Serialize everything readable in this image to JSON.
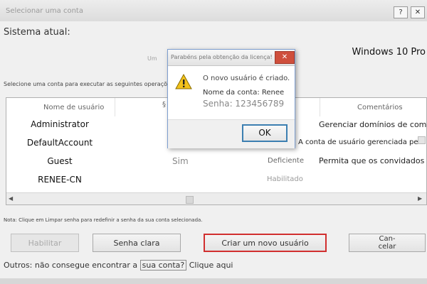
{
  "window": {
    "title": "Selecionar uma conta",
    "help_btn": "?",
    "close_btn": "✕"
  },
  "system": {
    "label": "Sistema atual:",
    "value": "Windows 10 Pro",
    "partial_text": "Um"
  },
  "instructions": "Selecione uma conta para executar as seguintes operações:",
  "table": {
    "headers": [
      "Nome de usuário",
      "Comentários"
    ],
    "hidden_header_glyph": "§",
    "rows": [
      {
        "name": "Administrator",
        "admin": "",
        "status": "",
        "comment": "Gerenciar domínios de computa"
      },
      {
        "name": "DefaultAccount",
        "admin": "",
        "status": "",
        "comment": "A conta de usuário gerenciada pelo sis"
      },
      {
        "name": "Guest",
        "admin": "Sim",
        "status": "Deficiente",
        "comment": "Permita que os convidados ace"
      },
      {
        "name": "RENEE-CN",
        "admin": "",
        "status": "Habilitado",
        "comment": ""
      }
    ]
  },
  "note": "Nota: Clique em Limpar senha para redefinir a senha da sua conta selecionada.",
  "buttons": {
    "enable": "Habilitar",
    "clear_password": "Senha clara",
    "create_user": "Criar um novo usuário",
    "cancel_line1": "Can-",
    "cancel_line2": "celar"
  },
  "bottom": {
    "prefix": "Outros: não consegue encontrar a",
    "link": "sua conta?",
    "suffix": "Clique aqui"
  },
  "dialog": {
    "title": "Parabéns pela obtenção da licença!",
    "close": "✕",
    "line1": "O novo usuário é criado.",
    "line2": "Nome da conta: Renee",
    "line3": "Senha: 123456789",
    "ok": "OK"
  },
  "colors": {
    "highlight_border": "#d12f2f",
    "dialog_close": "#cf4f3c",
    "ok_border": "#3c7fb1"
  }
}
